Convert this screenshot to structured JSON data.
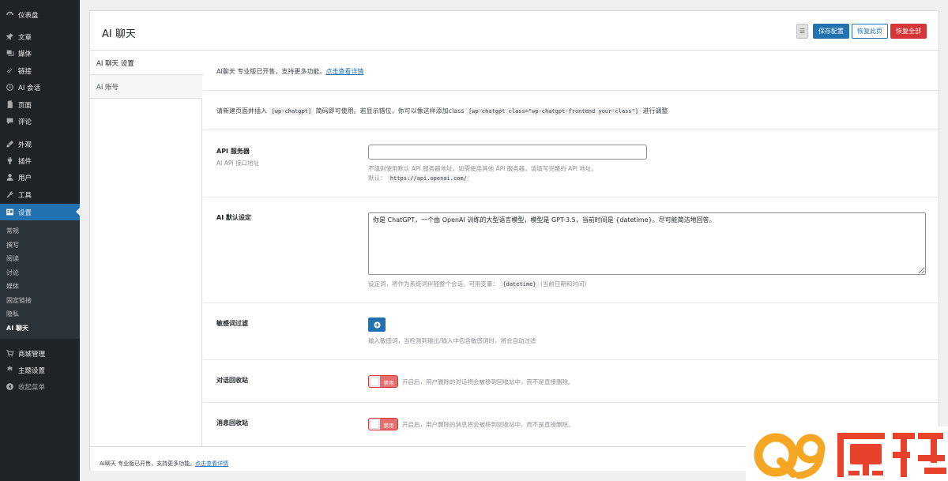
{
  "sidebar": {
    "items": [
      {
        "label": "仪表盘",
        "icon": "dashboard-icon"
      },
      {
        "label": "文章",
        "icon": "pin-icon"
      },
      {
        "label": "媒体",
        "icon": "media-icon"
      },
      {
        "label": "链接",
        "icon": "link-icon"
      },
      {
        "label": "AI 会话",
        "icon": "openai-icon"
      },
      {
        "label": "页面",
        "icon": "page-icon"
      },
      {
        "label": "评论",
        "icon": "comment-icon"
      },
      {
        "label": "外观",
        "icon": "brush-icon"
      },
      {
        "label": "插件",
        "icon": "plugin-icon"
      },
      {
        "label": "用户",
        "icon": "user-icon"
      },
      {
        "label": "工具",
        "icon": "wrench-icon"
      },
      {
        "label": "设置",
        "icon": "settings-icon"
      },
      {
        "label": "商城管理",
        "icon": "cart-icon"
      },
      {
        "label": "主题设置",
        "icon": "gear-icon"
      },
      {
        "label": "收起菜单",
        "icon": "collapse-icon"
      }
    ],
    "submenu": [
      "常规",
      "撰写",
      "阅读",
      "讨论",
      "媒体",
      "固定链接",
      "隐私",
      "AI 聊天"
    ]
  },
  "header": {
    "title": "AI 聊天",
    "toggle_icon": "list-icon",
    "save_label": "保存配置",
    "reset_page_label": "恢复此页",
    "reset_all_label": "恢复全部"
  },
  "tabs": [
    "AI 聊天 设置",
    "AI 账号"
  ],
  "notice": {
    "text": "AI聊天 专业版已开售，支持更多功能。",
    "link": "点击查看详情"
  },
  "shortcode_hint": {
    "before": "请新建页面并插入",
    "code1": "[wp-chatgpt]",
    "middle": "简码即可使用。若显示错位，你可以像这样添加class",
    "code2": "[wp-chatgpt class=\"wp-chatgpt-frontend your-class\"]",
    "after": "进行调整"
  },
  "api_server": {
    "label": "API 服务器",
    "sublabel": "AI API 接口地址",
    "value": "",
    "desc": "不填则使用默认 API 服务器地址，如需使用其他 API 服务器，请填写完整的 API 地址。",
    "default_label": "默认：",
    "default_value": "https://api.openai.com/"
  },
  "ai_default": {
    "label": "AI 默认设定",
    "value": "你是 ChatGPT，一个由 OpenAI 训练的大型语言模型，模型是 GPT-3.5，当前时间是 {datetime}。尽可能简洁地回答。",
    "desc_before": "设定词，将作为系统词伴随整个会话。可用变量：",
    "desc_code": "{datetime}",
    "desc_after": "(当前日期和时间)"
  },
  "sensitive": {
    "label": "敏感词过滤",
    "desc": "输入敏感词，当检测到输出/输入中包含敏感词时，将会自动过滤"
  },
  "chat_recycle": {
    "label": "对话回收站",
    "toggle_text": "禁用",
    "desc": "开启后，用户删除的对话将会被移到回收站中，而不是直接删除。"
  },
  "msg_recycle": {
    "label": "消息回收站",
    "toggle_text": "禁用",
    "desc": "开启后，用户删除的消息将会被移到回收站中，而不是直接删除。"
  },
  "footer": {
    "text": "AI聊天 专业版已开售，支持更多功能。",
    "link": "点击查看详情"
  },
  "watermark": {
    "brand": "Q9源码",
    "colors": {
      "orange": "#f5a623",
      "red": "#e8412c"
    }
  },
  "colors": {
    "sidebar_bg": "#1d2327",
    "accent": "#2271b1",
    "danger": "#d63638"
  }
}
